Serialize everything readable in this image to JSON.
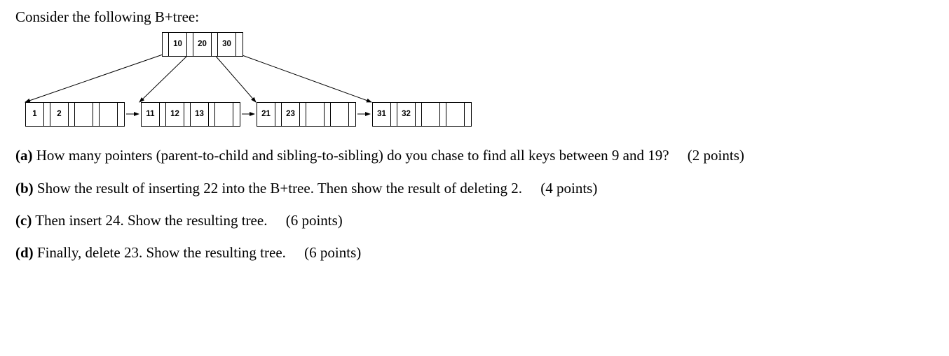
{
  "intro": "Consider the following B+tree:",
  "tree": {
    "root": {
      "keys": [
        "10",
        "20",
        "30"
      ],
      "slots": 4
    },
    "leaves": [
      {
        "keys": [
          "1",
          "2",
          "",
          ""
        ]
      },
      {
        "keys": [
          "11",
          "12",
          "13",
          ""
        ]
      },
      {
        "keys": [
          "21",
          "23",
          "",
          ""
        ]
      },
      {
        "keys": [
          "31",
          "32",
          "",
          ""
        ]
      }
    ]
  },
  "parts": [
    {
      "label": "(a)",
      "text": "How many pointers (parent-to-child and sibling-to-sibling) do you chase to find all keys between 9 and 19?",
      "points": "(2 points)"
    },
    {
      "label": "(b)",
      "text": "Show the result of inserting 22 into the B+tree. Then show the result of deleting 2.",
      "points": "(4 points)"
    },
    {
      "label": "(c)",
      "text": "Then insert 24. Show the resulting tree.",
      "points": "(6 points)"
    },
    {
      "label": "(d)",
      "text": "Finally, delete 23. Show the resulting tree.",
      "points": "(6 points)"
    }
  ]
}
